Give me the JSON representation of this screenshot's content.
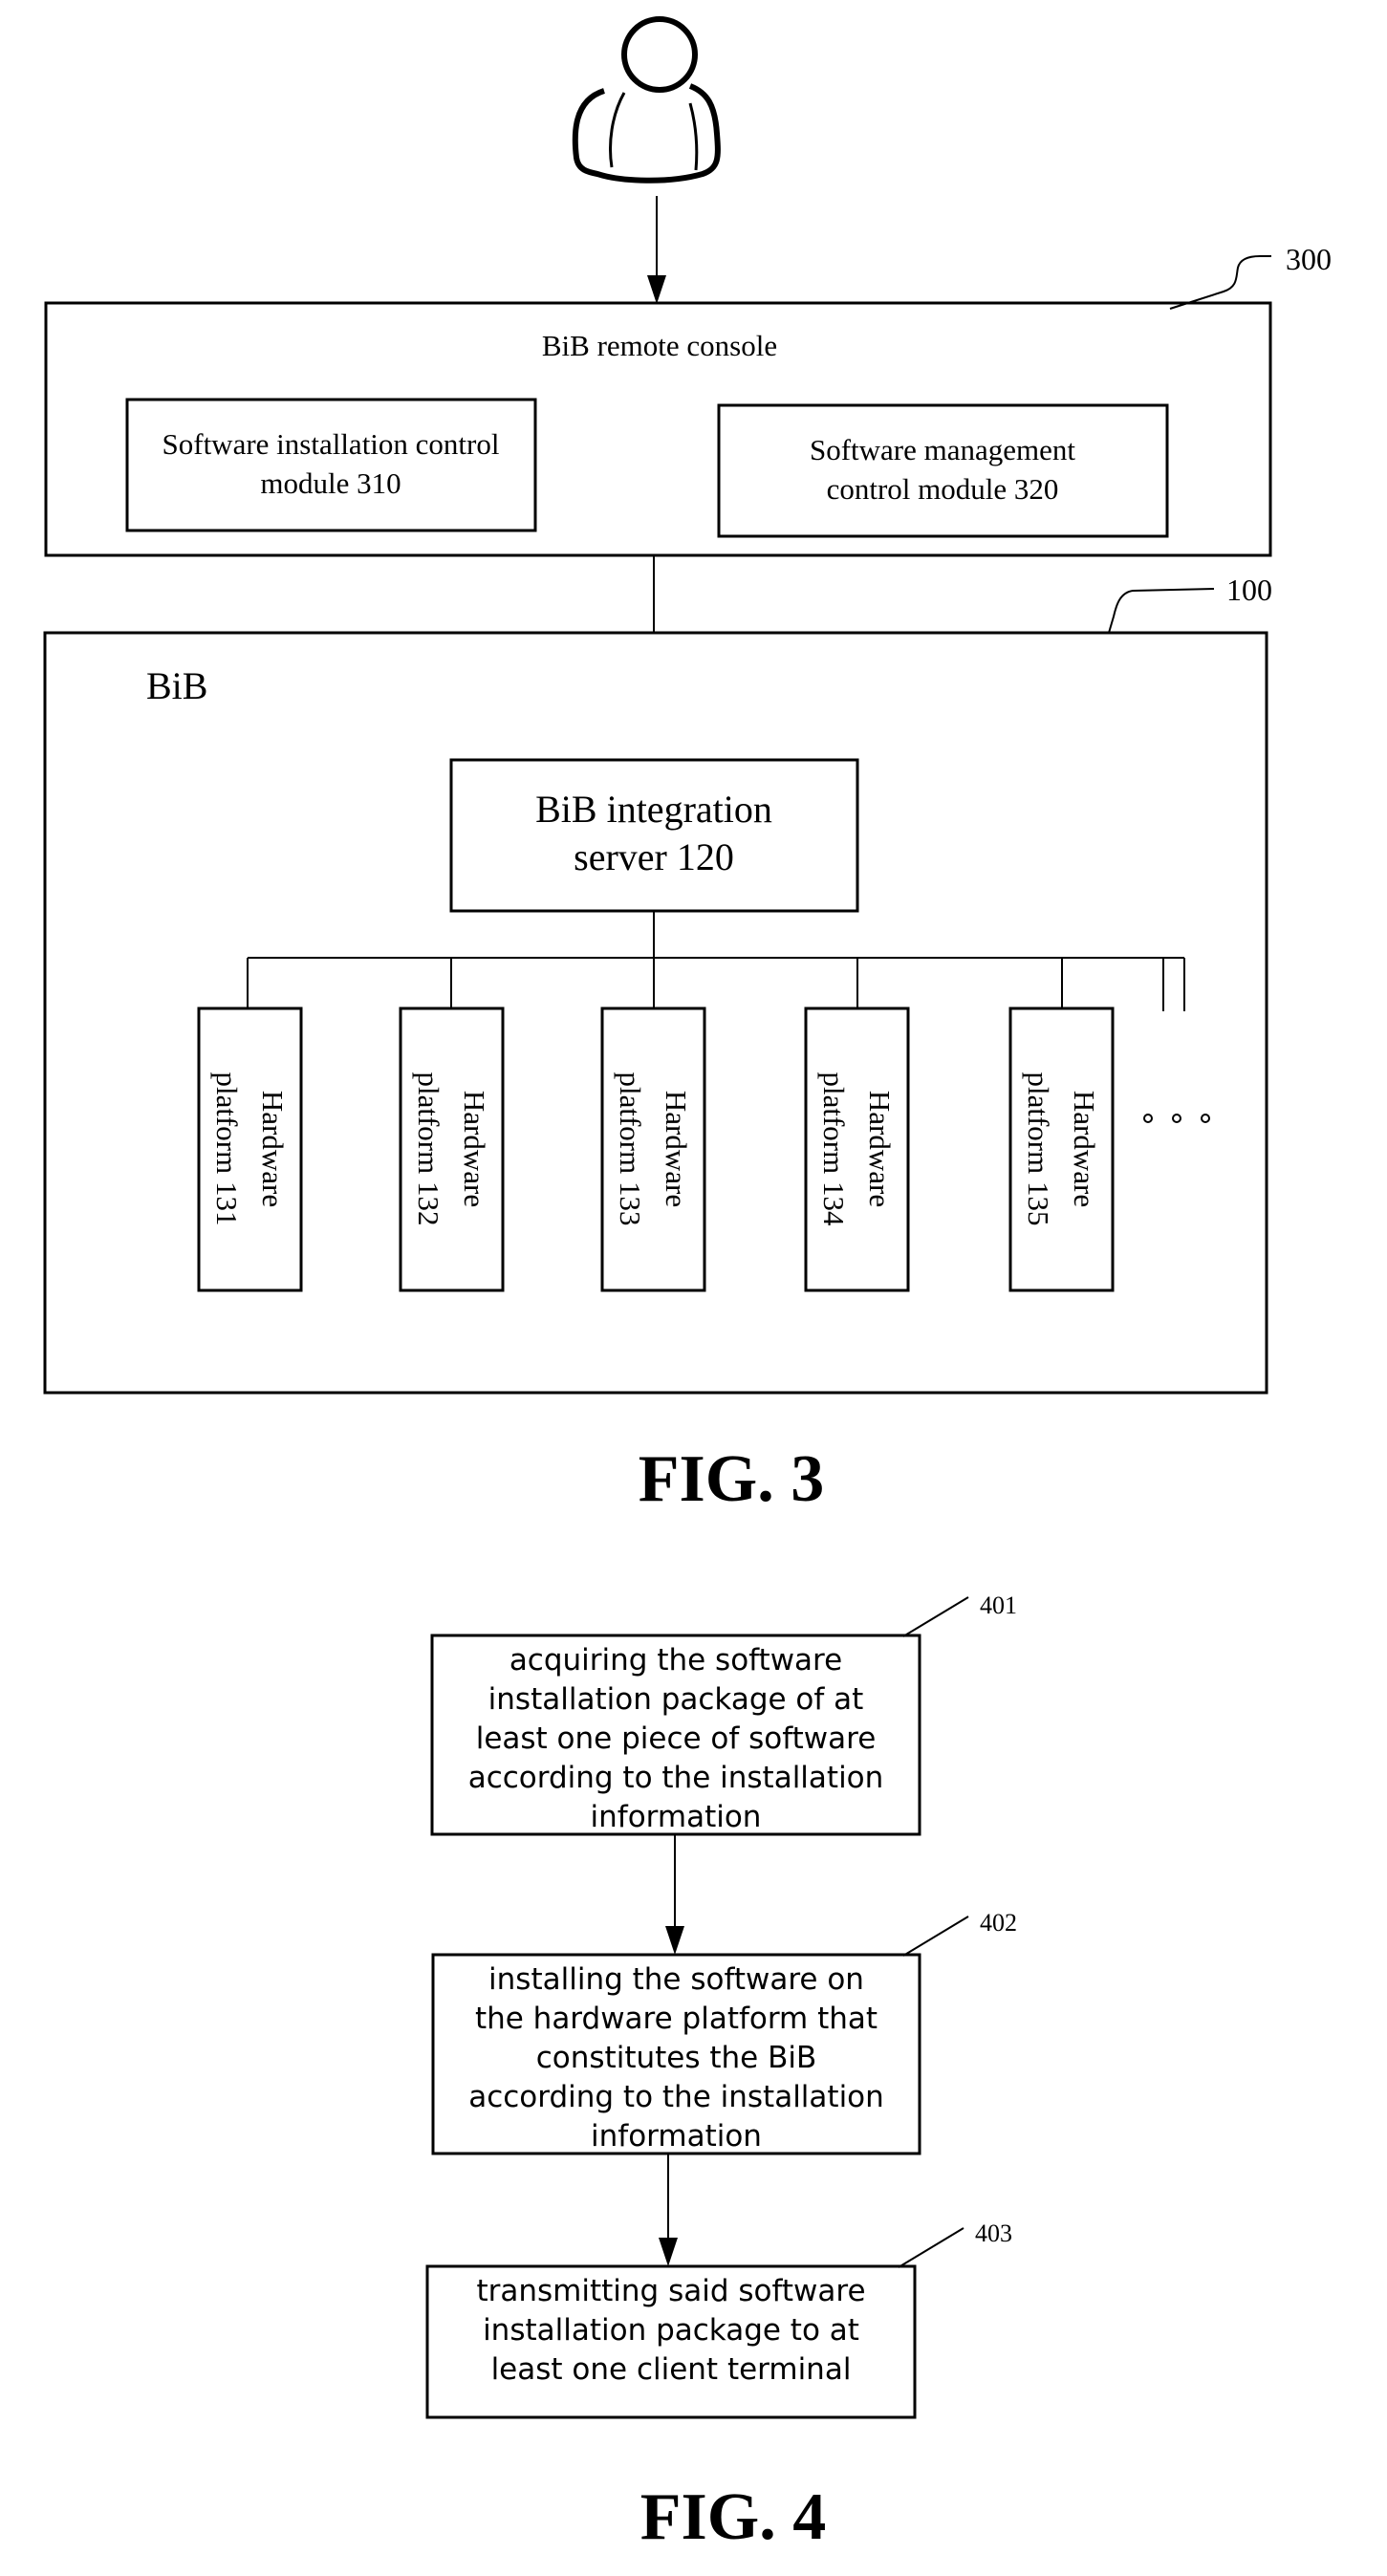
{
  "fig3": {
    "caption": "FIG. 3",
    "user_icon": "person-icon",
    "console": {
      "ref": "300",
      "title": "BiB remote console",
      "modules": [
        {
          "lines": [
            "Software installation control",
            "module 310"
          ]
        },
        {
          "lines": [
            "Software management",
            "control module 320"
          ]
        }
      ]
    },
    "bib": {
      "ref": "100",
      "title": "BiB",
      "server": {
        "lines": [
          "BiB integration",
          "server 120"
        ]
      },
      "platforms": [
        {
          "lines": [
            "Hardware",
            "platform 131"
          ]
        },
        {
          "lines": [
            "Hardware",
            "platform 132"
          ]
        },
        {
          "lines": [
            "Hardware",
            "platform 133"
          ]
        },
        {
          "lines": [
            "Hardware",
            "platform 134"
          ]
        },
        {
          "lines": [
            "Hardware",
            "platform 135"
          ]
        }
      ],
      "ellipsis": "° ° °"
    }
  },
  "fig4": {
    "caption": "FIG. 4",
    "steps": [
      {
        "ref": "401",
        "lines": [
          "acquiring the software",
          "installation package of at",
          "least one piece of software",
          "according to the installation",
          "information"
        ]
      },
      {
        "ref": "402",
        "lines": [
          "installing the  software on",
          "the hardware platform that",
          "constitutes the BiB",
          "according to the installation",
          "information"
        ]
      },
      {
        "ref": "403",
        "lines": [
          "transmitting said software",
          "installation package to at",
          "least one client terminal"
        ]
      }
    ]
  }
}
